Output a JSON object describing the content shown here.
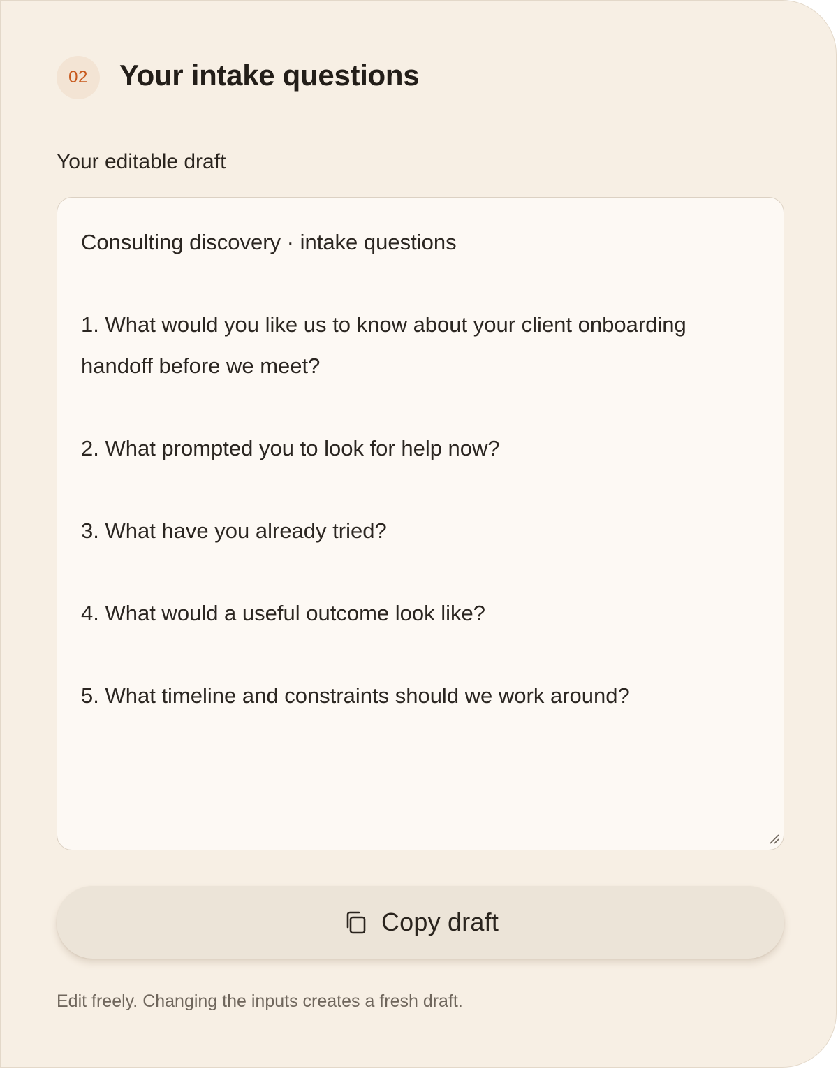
{
  "section": {
    "step_number": "02",
    "title": "Your intake questions"
  },
  "draft": {
    "label": "Your editable draft",
    "value": "Consulting discovery · intake questions\n\n1. What would you like us to know about your client onboarding handoff before we meet?\n\n2. What prompted you to look for help now?\n\n3. What have you already tried?\n\n4. What would a useful outcome look like?\n\n5. What timeline and constraints should we work around?"
  },
  "actions": {
    "copy_label": "Copy draft",
    "copy_icon": "copy-icon"
  },
  "hint": "Edit freely. Changing the inputs creates a fresh draft.",
  "colors": {
    "panel_background": "#f7efe4",
    "accent": "#c85a1e",
    "badge_background": "#f3e4d4",
    "button_background": "#ece4d8",
    "text_primary": "#231e19",
    "text_muted": "#6f665c"
  }
}
